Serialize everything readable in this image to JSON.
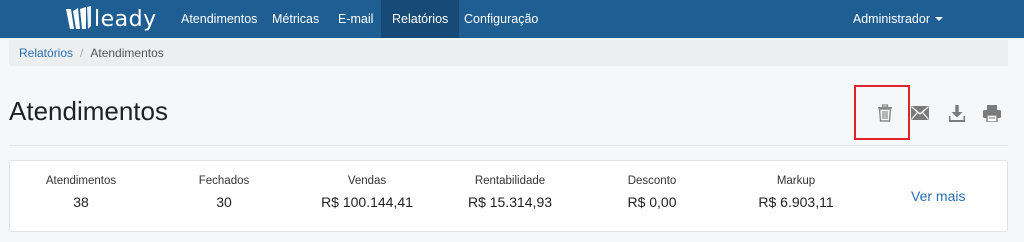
{
  "navbar": {
    "brand": "leady",
    "items": [
      {
        "label": "Atendimentos"
      },
      {
        "label": "Métricas"
      },
      {
        "label": "E-mail"
      },
      {
        "label": "Relatórios",
        "active": true
      },
      {
        "label": "Configuração"
      }
    ],
    "user_menu": "Administrador",
    "bg_color": "#1f5e92",
    "active_color": "#174a76"
  },
  "breadcrumb": {
    "items": [
      "Relatórios",
      "Atendimentos"
    ],
    "separator": "/"
  },
  "page": {
    "title": "Atendimentos"
  },
  "toolbar": {
    "icons": [
      "trash-icon",
      "envelope-icon",
      "download-icon",
      "print-icon"
    ],
    "highlighted": "trash-icon",
    "highlight_color": "#e0252a"
  },
  "stats": {
    "items": [
      {
        "label": "Atendimentos",
        "value": "38"
      },
      {
        "label": "Fechados",
        "value": "30"
      },
      {
        "label": "Vendas",
        "value": "R$ 100.144,41"
      },
      {
        "label": "Rentabilidade",
        "value": "R$ 15.314,93"
      },
      {
        "label": "Desconto",
        "value": "R$ 0,00"
      },
      {
        "label": "Markup",
        "value": "R$ 6.903,11"
      }
    ],
    "more_link": "Ver mais"
  }
}
